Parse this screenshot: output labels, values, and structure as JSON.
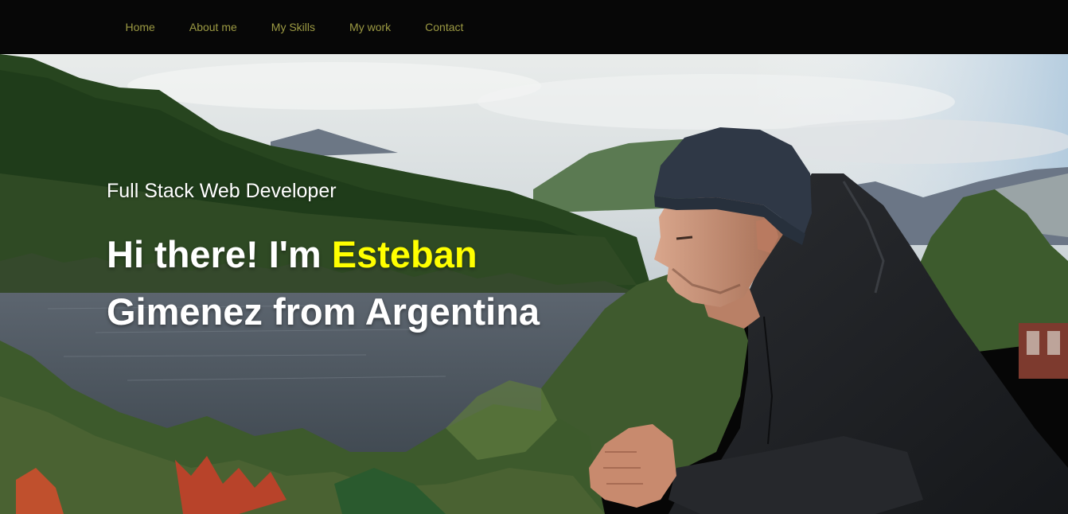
{
  "nav": {
    "items": [
      {
        "label": "Home"
      },
      {
        "label": "About me"
      },
      {
        "label": "My Skills"
      },
      {
        "label": "My work"
      },
      {
        "label": "Contact"
      }
    ]
  },
  "hero": {
    "subtitle": "Full Stack Web Developer",
    "headline_prefix": "Hi there! I'm ",
    "headline_name": "Esteban",
    "headline_suffix": "Gimenez from Argentina",
    "background_image": "photo of man in black beanie and jacket overlooking a lake with forested mountains"
  },
  "colors": {
    "navbar_bg": "#070707",
    "nav_link": "#9c9a43",
    "name_highlight": "#ffff00",
    "headline_text": "#ffffff"
  }
}
